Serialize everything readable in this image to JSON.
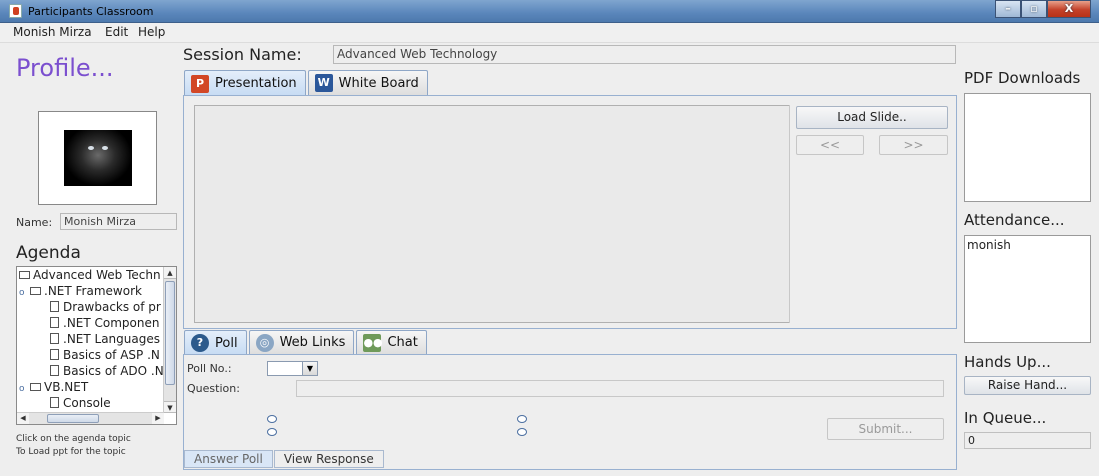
{
  "window": {
    "title": "Participants Classroom",
    "buttons": [
      "–",
      "▫",
      "X"
    ]
  },
  "menu": [
    "Monish Mirza",
    "Edit",
    "Help"
  ],
  "profile": {
    "heading": "Profile...",
    "name_label": "Name:",
    "name_value": "Monish Mirza"
  },
  "agenda": {
    "heading": "Agenda",
    "tree": [
      {
        "label": "Advanced Web Techn",
        "type": "folder",
        "indent": 0
      },
      {
        "label": ".NET Framework",
        "type": "folder",
        "indent": 1
      },
      {
        "label": "Drawbacks of pr",
        "type": "doc",
        "indent": 2
      },
      {
        "label": ".NET Componen",
        "type": "doc",
        "indent": 2
      },
      {
        "label": ".NET Languages",
        "type": "doc",
        "indent": 2
      },
      {
        "label": "Basics of ASP .N",
        "type": "doc",
        "indent": 2
      },
      {
        "label": "Basics of ADO .N",
        "type": "doc",
        "indent": 2
      },
      {
        "label": "VB.NET",
        "type": "folder",
        "indent": 1
      },
      {
        "label": "Console",
        "type": "doc",
        "indent": 2
      }
    ],
    "hint_line1": "Click on the agenda topic",
    "hint_line2": "To Load ppt for the topic"
  },
  "session": {
    "label": "Session Name:",
    "value": "Advanced Web Technology"
  },
  "main_tabs": [
    {
      "label": "Presentation",
      "icon": "powerpoint-icon",
      "active": true
    },
    {
      "label": "White Board",
      "icon": "word-icon",
      "active": false
    }
  ],
  "slide_controls": {
    "load": "Load Slide..",
    "prev": "<<",
    "next": ">>"
  },
  "bottom_tabs": [
    {
      "label": "Poll",
      "icon": "question-icon",
      "active": true
    },
    {
      "label": "Web Links",
      "icon": "globe-icon",
      "active": false
    },
    {
      "label": "Chat",
      "icon": "people-icon",
      "active": false
    }
  ],
  "poll": {
    "poll_no_label": "Poll No.:",
    "question_label": "Question:",
    "submit": "Submit...",
    "subtabs": [
      "Answer Poll",
      "View Response"
    ]
  },
  "right": {
    "pdf_heading": "PDF Downloads",
    "attendance_heading": "Attendance...",
    "attendance": [
      "monish"
    ],
    "hands_heading": "Hands Up...",
    "raise_hand": "Raise Hand...",
    "queue_heading": "In Queue...",
    "queue_value": "0"
  },
  "colors": {
    "profile_heading": "#7b4fcf",
    "tab_active": "#c6dbf3",
    "titlebar": "#5a86bb"
  }
}
